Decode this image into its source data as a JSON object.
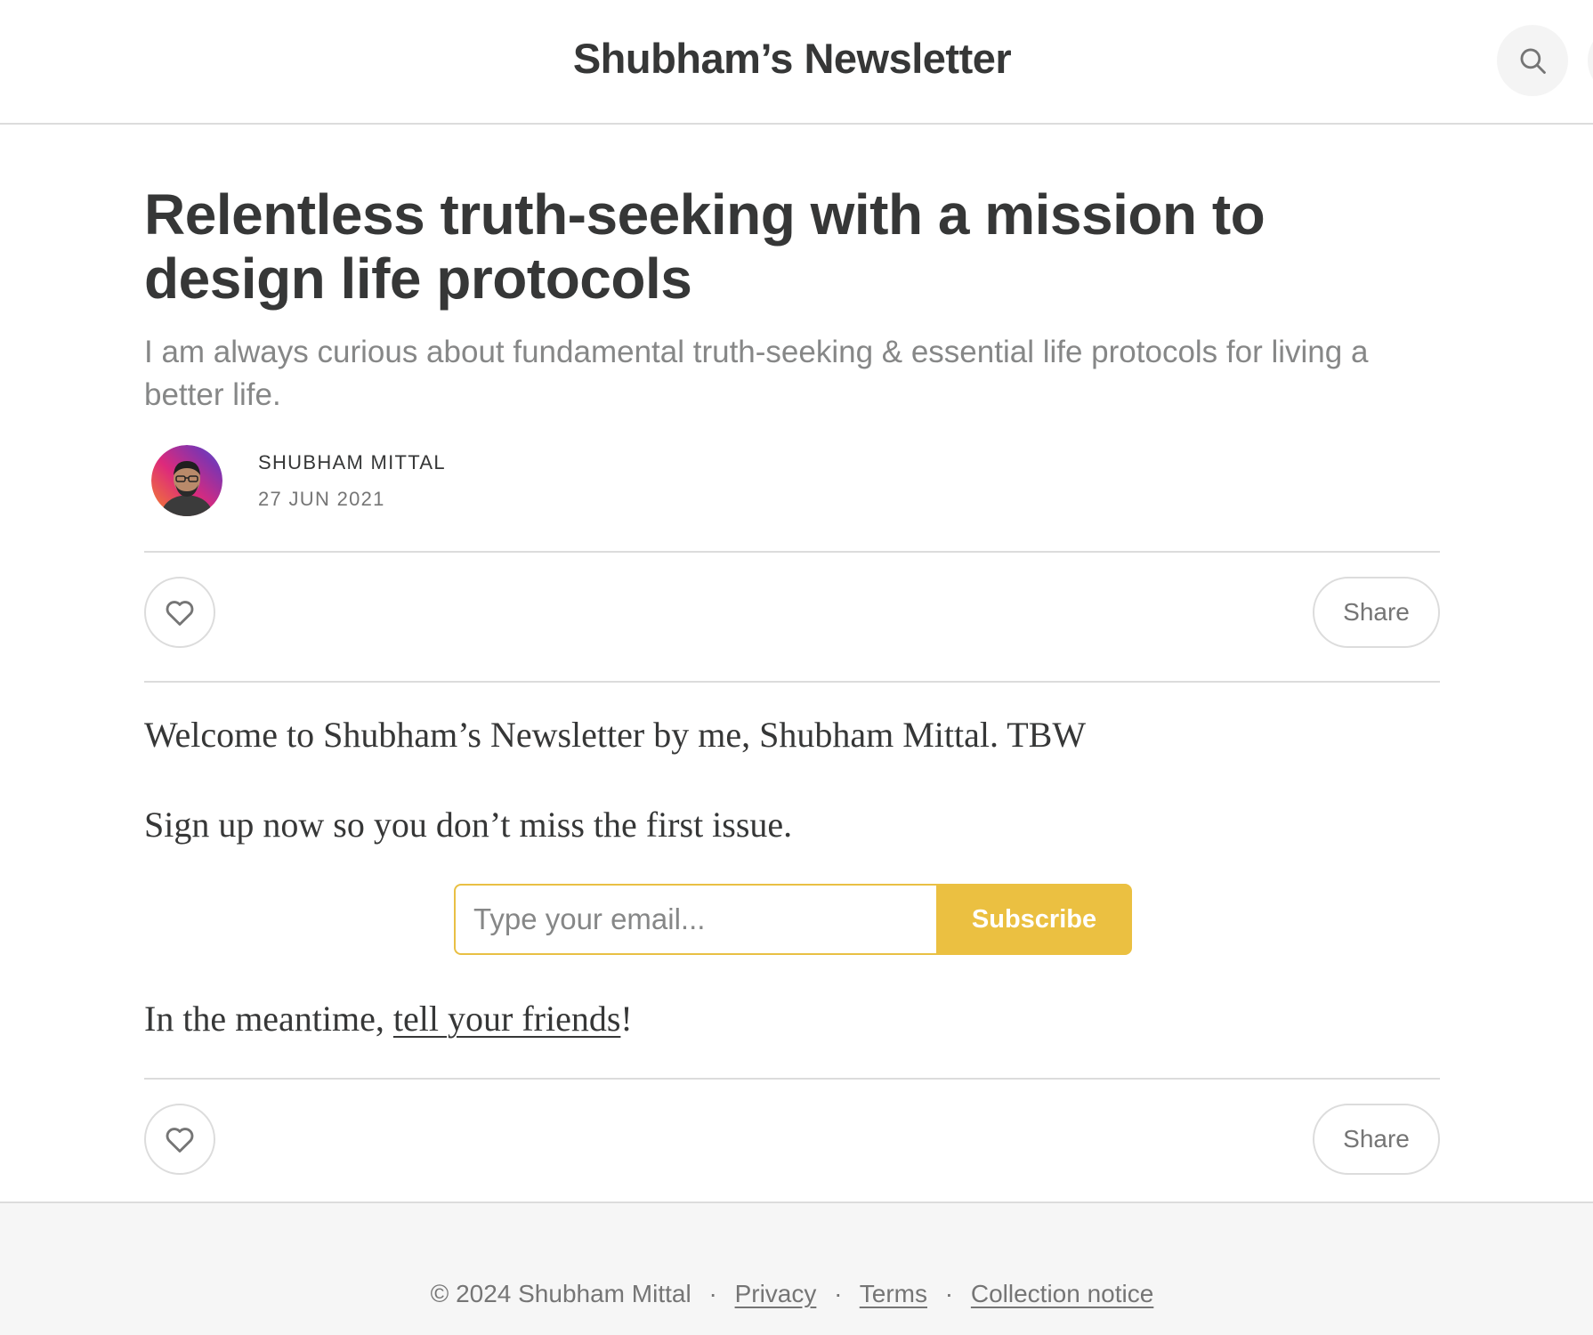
{
  "header": {
    "site_title": "Shubham’s Newsletter",
    "search_icon": "search-icon"
  },
  "post": {
    "title": "Relentless truth-seeking with a mission to design life protocols",
    "subtitle": "I am always curious about fundamental truth-seeking & essential life protocols for living a better life.",
    "author": "SHUBHAM MITTAL",
    "date": "27 JUN 2021",
    "like_icon": "heart-icon",
    "share_label": "Share"
  },
  "body": {
    "welcome": "Welcome to Shubham’s Newsletter by me, Shubham Mittal. TBW",
    "signup": "Sign up now so you don’t miss the first issue.",
    "meantime_prefix": "In the meantime, ",
    "friends_link": "tell your friends",
    "meantime_suffix": "!"
  },
  "subscribe": {
    "placeholder": "Type your email...",
    "button_label": "Subscribe"
  },
  "footer": {
    "copyright": "© 2024 Shubham Mittal",
    "separator": "·",
    "privacy": "Privacy",
    "terms": "Terms",
    "collection_notice": "Collection notice"
  },
  "colors": {
    "accent": "#ebc041",
    "text": "#363737",
    "muted": "#868787",
    "border": "#dcdcdc"
  }
}
